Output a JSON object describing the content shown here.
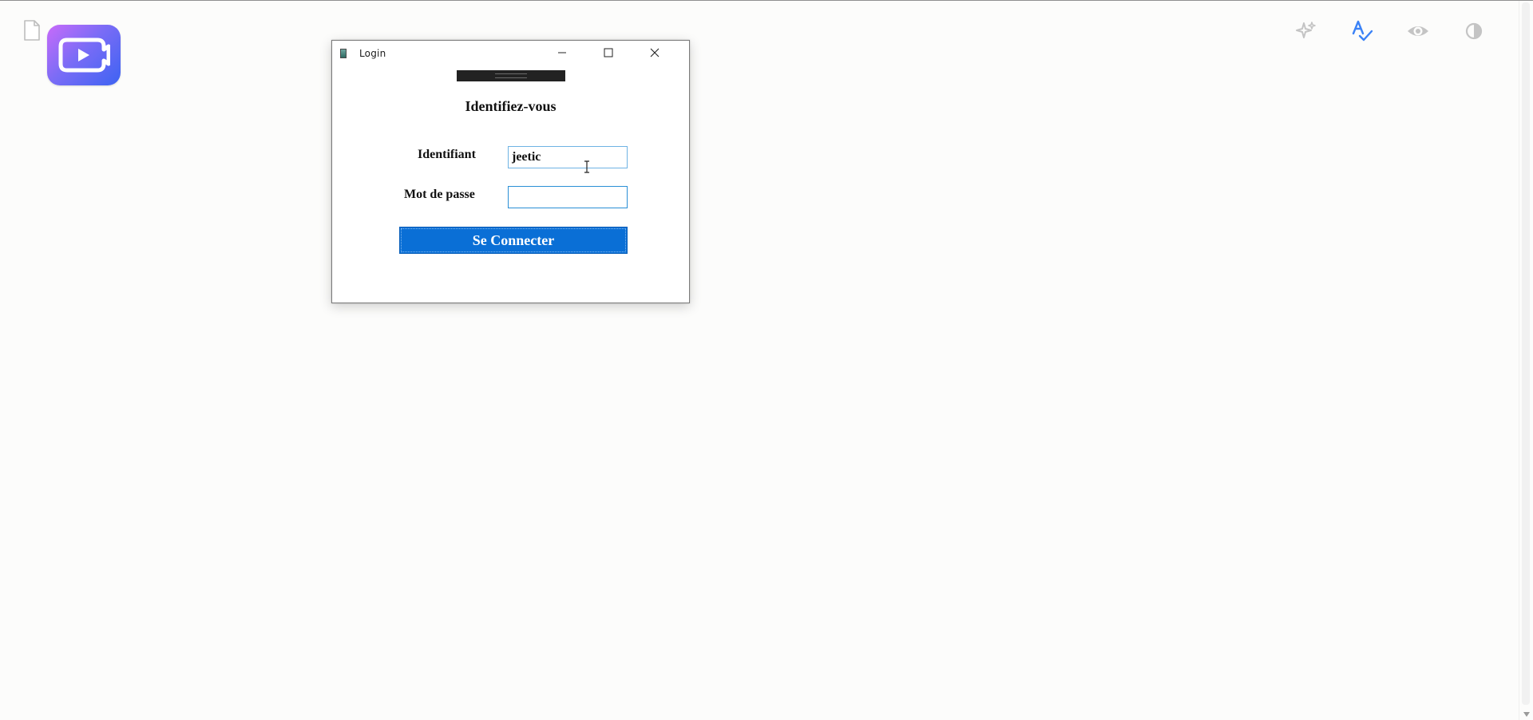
{
  "window": {
    "title": "Login",
    "heading": "Identifiez-vous",
    "username_label": "Identifiant",
    "username_value": "jeetic",
    "password_label": "Mot de passe",
    "password_value": "",
    "submit_label": "Se Connecter"
  },
  "toolbar": {
    "icons": [
      "sparkles-icon",
      "spellcheck-icon",
      "eye-icon",
      "contrast-icon",
      "expand-icon"
    ]
  },
  "colors": {
    "accent": "#0a6fd6",
    "logo_gradient_start": "#c86bfa",
    "logo_gradient_end": "#3d63f2",
    "spellcheck_active": "#3b82f6",
    "toolbar_icon": "#c4c4c4"
  }
}
